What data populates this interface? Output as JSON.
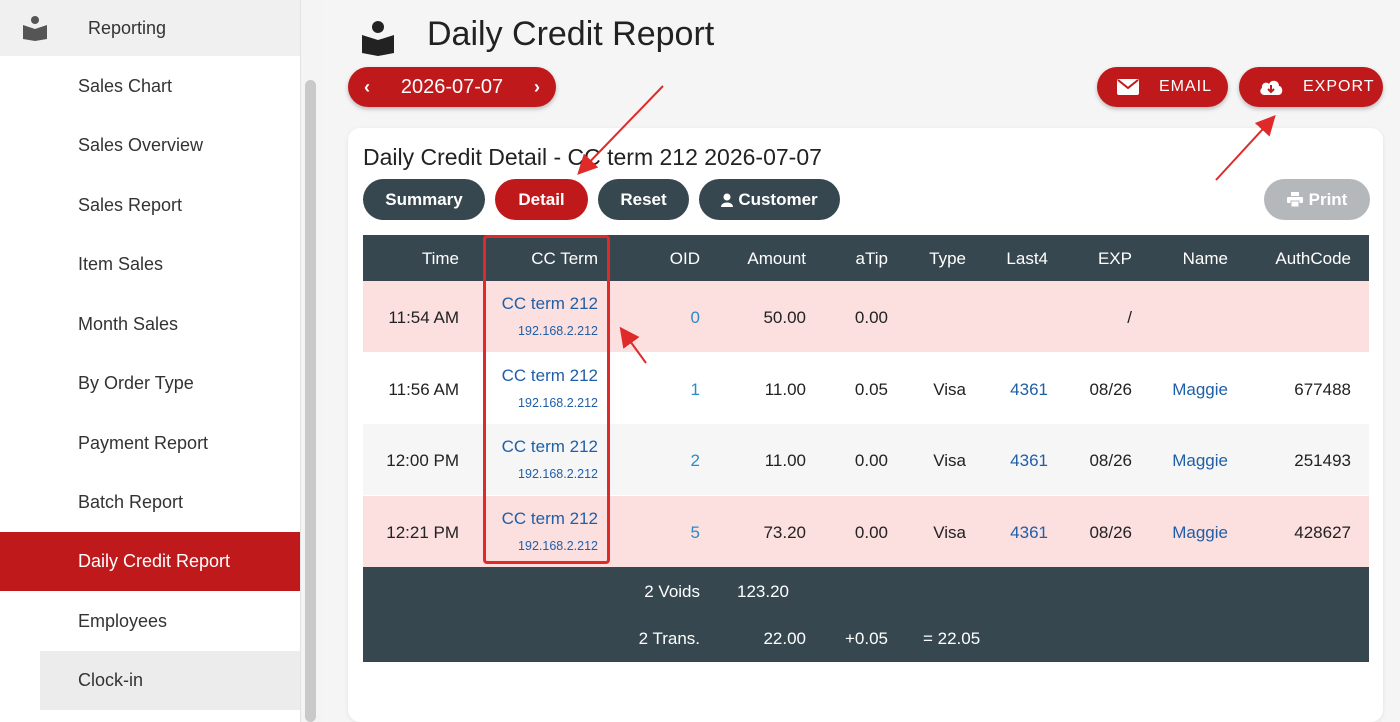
{
  "sidebar": {
    "header": "Reporting",
    "items": [
      {
        "label": "Sales Chart"
      },
      {
        "label": "Sales Overview"
      },
      {
        "label": "Sales Report"
      },
      {
        "label": "Item Sales"
      },
      {
        "label": "Month Sales"
      },
      {
        "label": "By Order Type"
      },
      {
        "label": "Payment Report"
      },
      {
        "label": "Batch Report"
      },
      {
        "label": "Daily Credit Report"
      },
      {
        "label": "Employees"
      },
      {
        "label": "Clock-in"
      }
    ],
    "active_item": "Daily Credit Report"
  },
  "header": {
    "title": "Daily Credit Report"
  },
  "date_picker": {
    "prev": "‹",
    "date": "2026-07-07",
    "next": "›"
  },
  "actions": {
    "email": "EMAIL",
    "export": "EXPORT"
  },
  "card": {
    "title": "Daily Credit Detail - CC term 212 2026-07-07",
    "tabs": {
      "summary": "Summary",
      "detail": "Detail",
      "reset": "Reset",
      "customer": "Customer"
    },
    "print": "Print"
  },
  "table": {
    "headers": {
      "time": "Time",
      "cc_term": "CC Term",
      "oid": "OID",
      "amount": "Amount",
      "atip": "aTip",
      "type": "Type",
      "last4": "Last4",
      "exp": "EXP",
      "name": "Name",
      "authcode": "AuthCode"
    },
    "rows": [
      {
        "time": "11:54 AM",
        "term": "CC term 212",
        "ip": "192.168.2.212",
        "oid": "0",
        "amount": "50.00",
        "atip": "0.00",
        "type": "",
        "last4": "",
        "exp": "/",
        "name": "",
        "authcode": "",
        "voided": true
      },
      {
        "time": "11:56 AM",
        "term": "CC term 212",
        "ip": "192.168.2.212",
        "oid": "1",
        "amount": "11.00",
        "atip": "0.05",
        "type": "Visa",
        "last4": "4361",
        "exp": "08/26",
        "name": "Maggie",
        "authcode": "677488",
        "voided": false
      },
      {
        "time": "12:00 PM",
        "term": "CC term 212",
        "ip": "192.168.2.212",
        "oid": "2",
        "amount": "11.00",
        "atip": "0.00",
        "type": "Visa",
        "last4": "4361",
        "exp": "08/26",
        "name": "Maggie",
        "authcode": "251493",
        "voided": false
      },
      {
        "time": "12:21 PM",
        "term": "CC term 212",
        "ip": "192.168.2.212",
        "oid": "5",
        "amount": "73.20",
        "atip": "0.00",
        "type": "Visa",
        "last4": "4361",
        "exp": "08/26",
        "name": "Maggie",
        "authcode": "428627",
        "voided": true
      }
    ],
    "footer": {
      "voids_label": "2 Voids",
      "voids_amount": "123.20",
      "trans_label": "2 Trans.",
      "trans_amount": "22.00",
      "trans_tip": "+0.05",
      "trans_total": "= 22.05"
    }
  },
  "colors": {
    "accent": "#c0191c",
    "header_dark": "#37474f",
    "void_row": "#fcdfdf",
    "link": "#1f5fa8"
  }
}
